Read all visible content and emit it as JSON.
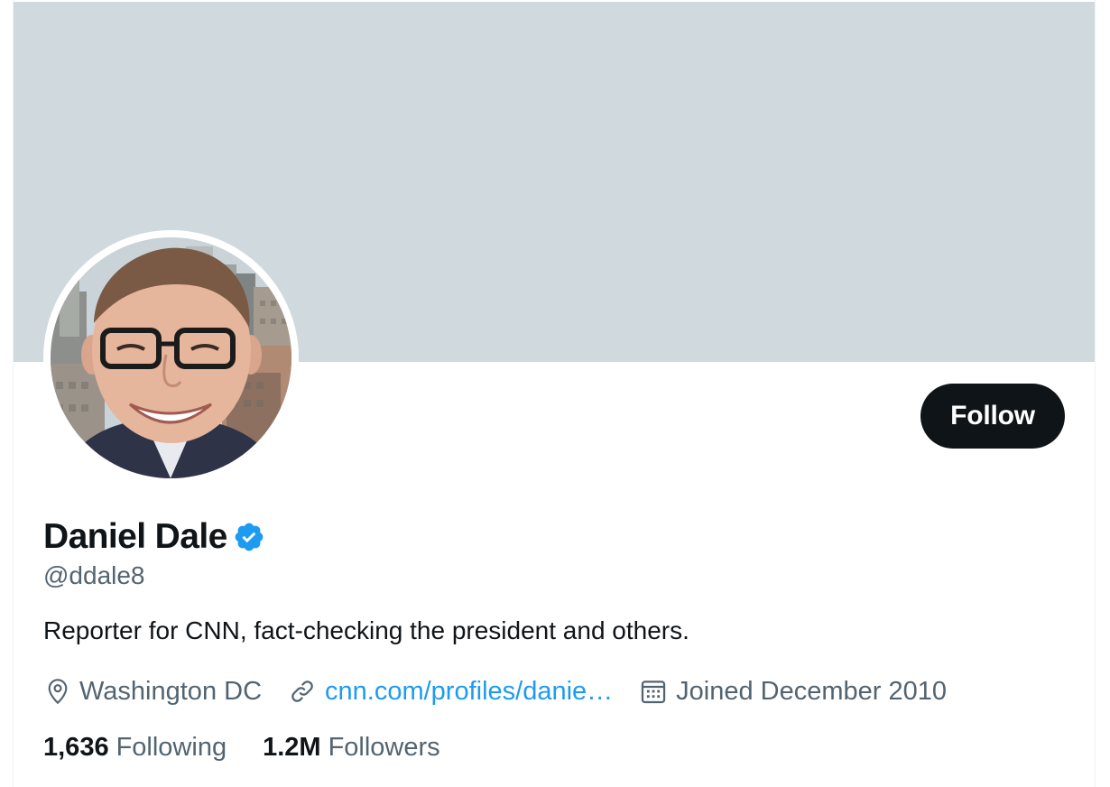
{
  "profile": {
    "display_name": "Daniel Dale",
    "verified": true,
    "handle": "@ddale8",
    "bio": "Reporter for CNN, fact-checking the president and others.",
    "follow_label": "Follow"
  },
  "meta": {
    "location": "Washington DC",
    "location_icon": "location-pin-icon",
    "website": "cnn.com/profiles/danie…",
    "website_icon": "link-icon",
    "joined": "Joined December 2010",
    "joined_icon": "calendar-icon"
  },
  "stats": {
    "following_count": "1,636",
    "following_label": "Following",
    "followers_count": "1.2M",
    "followers_label": "Followers"
  },
  "colors": {
    "banner": "#cfd9de",
    "accent": "#1d9bf0",
    "verified": "#1d9bf0",
    "follow_button": "#0f1419",
    "text_primary": "#0f1419",
    "text_secondary": "#536471"
  }
}
